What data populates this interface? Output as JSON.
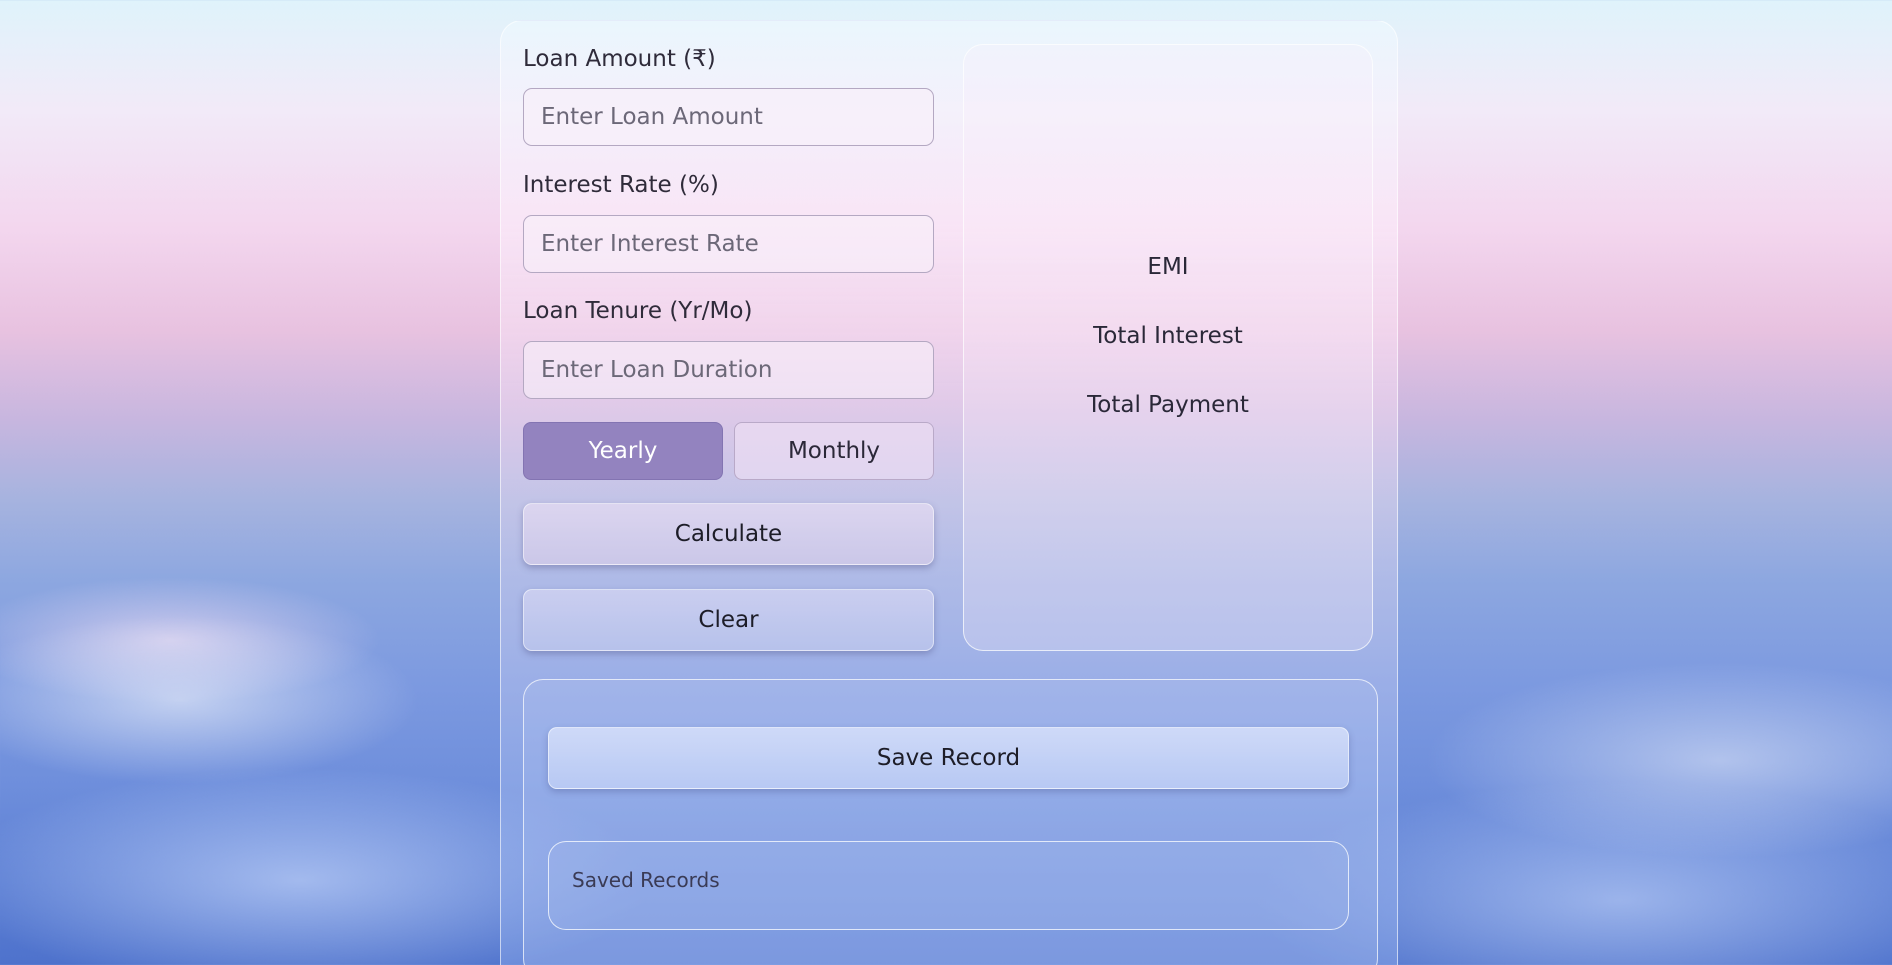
{
  "form": {
    "loan_amount_label": "Loan Amount (₹)",
    "loan_amount_placeholder": "Enter Loan Amount",
    "interest_rate_label": "Interest Rate (%)",
    "interest_rate_placeholder": "Enter Interest Rate",
    "tenure_label": "Loan Tenure (Yr/Mo)",
    "tenure_placeholder": "Enter Loan Duration",
    "tenure_modes": [
      "Yearly",
      "Monthly"
    ],
    "selected_mode": "Yearly",
    "calculate_label": "Calculate",
    "clear_label": "Clear"
  },
  "results": {
    "emi_label": "EMI",
    "total_interest_label": "Total Interest",
    "total_payment_label": "Total Payment"
  },
  "records": {
    "save_label": "Save Record",
    "saved_title": "Saved Records"
  },
  "colors": {
    "active_toggle": "#9383bf",
    "text": "#2f2b3a"
  }
}
